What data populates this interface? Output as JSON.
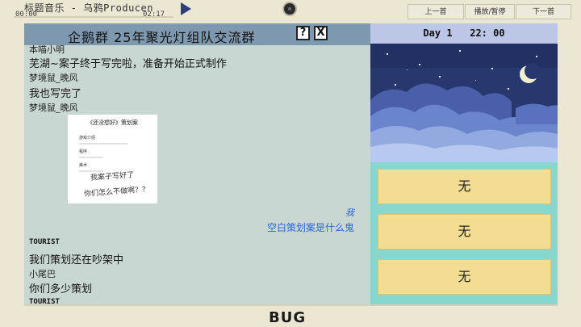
{
  "top_bar": {
    "music_title": "标题音乐 - 乌鸦Producen",
    "time_current": "00:00",
    "time_total": "02:17",
    "progress": 0,
    "play_icon": "play-icon",
    "prev_label": "上一首",
    "pause_label": "播放/暂停",
    "next_label": "下一首"
  },
  "chat": {
    "group_title": "企鹅群  25年聚光灯组队交流群",
    "help_label": "?",
    "close_label": "X",
    "messages": [
      {
        "sender": "本喵小明"
      },
      {
        "text": "芜湖~案子终于写完啦，准备开始正式制作"
      },
      {
        "sender": "梦境鼠_晚风"
      },
      {
        "text": "我也写完了"
      },
      {
        "sender": "梦境鼠_晚风"
      },
      {
        "sender": "我",
        "text": "空白策划案是什么鬼"
      },
      {
        "sender": "TOURIST",
        "text": "我们策划还在吵架中"
      },
      {
        "sender": "小尾巴",
        "text": "你们多少策划"
      },
      {
        "sender": "TOURIST"
      }
    ],
    "document": {
      "title": "《还没想好》策划案",
      "sections": [
        "游戏介绍",
        "程序",
        "美术"
      ],
      "overlay_line1": "我案子写好了",
      "overlay_line2": "你们怎么不做啊？？"
    }
  },
  "panel": {
    "day_text": "Day 1   22: 00",
    "choices": [
      "无",
      "无",
      "无"
    ]
  },
  "brand": "BUG",
  "colors": {
    "chat_bg": "#c9d7d3",
    "chat_header": "#7d98af",
    "choice_bg": "#f2dd93",
    "panel_bg": "#86d7cd",
    "self_message": "#2a67d3"
  }
}
